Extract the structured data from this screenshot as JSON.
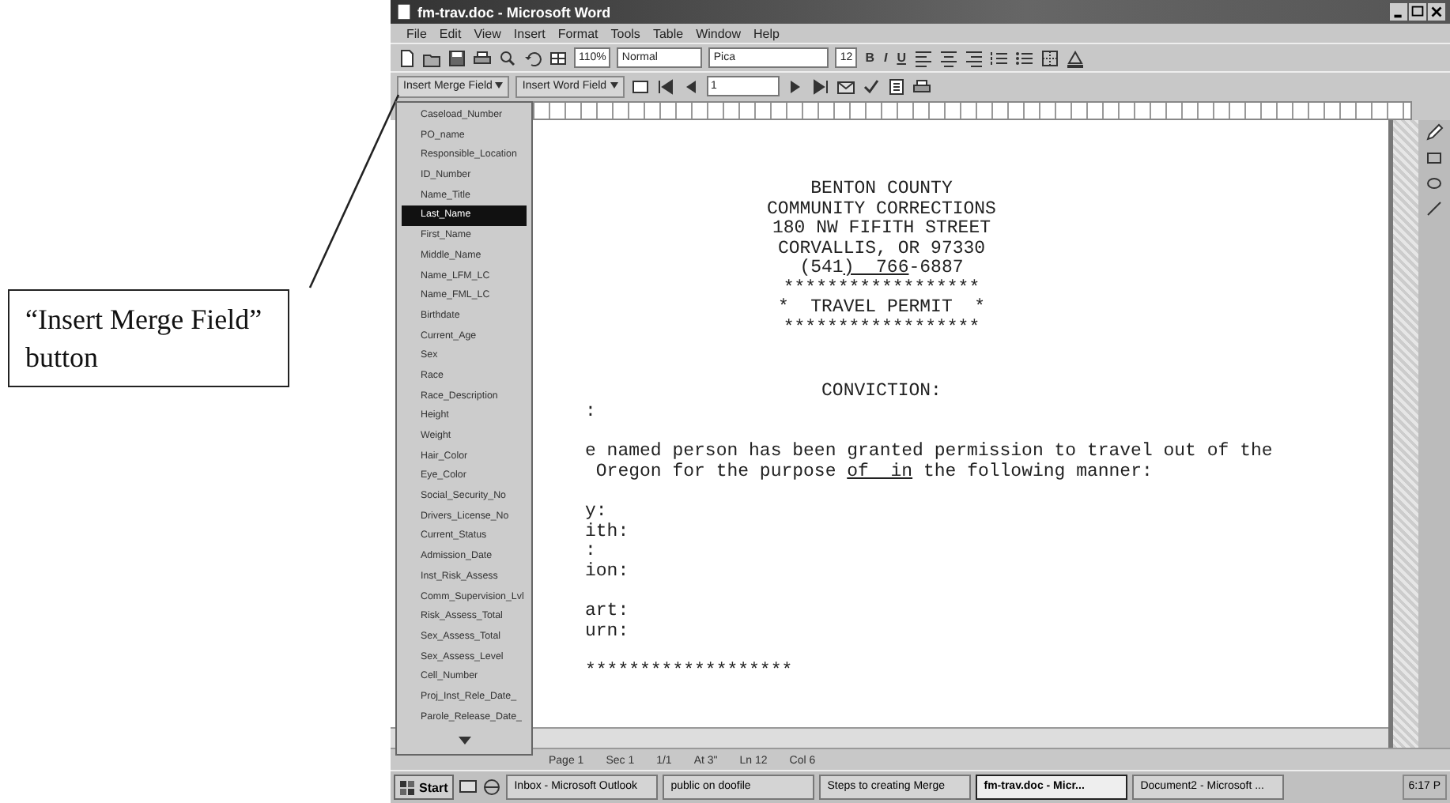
{
  "callout": {
    "text": "“Insert Merge Field” button"
  },
  "window": {
    "title": "fm-trav.doc - Microsoft Word"
  },
  "menu_bar": [
    "File",
    "Edit",
    "View",
    "Insert",
    "Format",
    "Tools",
    "Table",
    "Window",
    "Help"
  ],
  "toolbar": {
    "zoom": "110%",
    "style": "Normal",
    "font": "Pica",
    "size": "12",
    "bold": "B",
    "italic": "I",
    "underline": "U"
  },
  "mail_merge_toolbar": {
    "insert_merge_field": "Insert Merge Field",
    "insert_word_field": "Insert Word Field",
    "record": "1"
  },
  "merge_field_menu": {
    "items": [
      {
        "label": "Caseload_Number",
        "selected": false
      },
      {
        "label": "PO_name",
        "selected": false
      },
      {
        "label": "Responsible_Location",
        "selected": false
      },
      {
        "label": "ID_Number",
        "selected": false
      },
      {
        "label": "Name_Title",
        "selected": false
      },
      {
        "label": "Last_Name",
        "selected": true
      },
      {
        "label": "First_Name",
        "selected": false
      },
      {
        "label": "Middle_Name",
        "selected": false
      },
      {
        "label": "Name_LFM_LC",
        "selected": false
      },
      {
        "label": "Name_FML_LC",
        "selected": false
      },
      {
        "label": "Birthdate",
        "selected": false
      },
      {
        "label": "Current_Age",
        "selected": false
      },
      {
        "label": "Sex",
        "selected": false
      },
      {
        "label": "Race",
        "selected": false
      },
      {
        "label": "Race_Description",
        "selected": false
      },
      {
        "label": "Height",
        "selected": false
      },
      {
        "label": "Weight",
        "selected": false
      },
      {
        "label": "Hair_Color",
        "selected": false
      },
      {
        "label": "Eye_Color",
        "selected": false
      },
      {
        "label": "Social_Security_No",
        "selected": false
      },
      {
        "label": "Drivers_License_No",
        "selected": false
      },
      {
        "label": "Current_Status",
        "selected": false
      },
      {
        "label": "Admission_Date",
        "selected": false
      },
      {
        "label": "Inst_Risk_Assess",
        "selected": false
      },
      {
        "label": "Comm_Supervision_Lvl",
        "selected": false
      },
      {
        "label": "Risk_Assess_Total",
        "selected": false
      },
      {
        "label": "Sex_Assess_Total",
        "selected": false
      },
      {
        "label": "Sex_Assess_Level",
        "selected": false
      },
      {
        "label": "Cell_Number",
        "selected": false
      },
      {
        "label": "Proj_Inst_Rele_Date_",
        "selected": false
      },
      {
        "label": "Parole_Release_Date_",
        "selected": false
      }
    ]
  },
  "document": {
    "header": [
      {
        "segments": [
          {
            "text": "BENTON COUNTY",
            "underline": false
          }
        ]
      },
      {
        "segments": [
          {
            "text": "COMMUNITY CORRECTIONS",
            "underline": false
          }
        ]
      },
      {
        "segments": [
          {
            "text": "180 NW FIFITH STREET",
            "underline": false
          }
        ]
      },
      {
        "segments": [
          {
            "text": "CORVALLIS, OR 97330",
            "underline": false
          }
        ]
      },
      {
        "segments": [
          {
            "text": "(541",
            "underline": false
          },
          {
            "text": ")  766",
            "underline": true
          },
          {
            "text": "-6887",
            "underline": false
          }
        ]
      },
      {
        "segments": [
          {
            "text": "******************",
            "underline": false
          }
        ]
      },
      {
        "segments": [
          {
            "text": "*  TRAVEL PERMIT  *",
            "underline": false
          }
        ]
      },
      {
        "segments": [
          {
            "text": "******************",
            "underline": false
          }
        ]
      }
    ],
    "section_title": "CONVICTION:",
    "body": [
      [
        {
          "segments": [
            {
              "text": ":",
              "underline": false
            }
          ]
        }
      ],
      [
        {
          "segments": [
            {
              "text": "e named person has been granted permission to travel out of the",
              "underline": false
            }
          ]
        },
        {
          "segments": [
            {
              "text": " Oregon for the purpose ",
              "underline": false
            },
            {
              "text": "of  in",
              "underline": true
            },
            {
              "text": " the following manner:",
              "underline": false
            }
          ]
        }
      ],
      [
        {
          "segments": [
            {
              "text": "y:",
              "underline": false
            }
          ]
        },
        {
          "segments": [
            {
              "text": "ith:",
              "underline": false
            }
          ]
        },
        {
          "segments": [
            {
              "text": ":",
              "underline": false
            }
          ]
        },
        {
          "segments": [
            {
              "text": "ion:",
              "underline": false
            }
          ]
        }
      ],
      [
        {
          "segments": [
            {
              "text": "art:",
              "underline": false
            }
          ]
        },
        {
          "segments": [
            {
              "text": "urn:",
              "underline": false
            }
          ]
        }
      ],
      [
        {
          "segments": [
            {
              "text": "*******************",
              "underline": false
            }
          ]
        }
      ]
    ]
  },
  "status_bar": {
    "page": "Page 1",
    "section": "Sec 1",
    "pages": "1/1",
    "at": "At 3\"",
    "line": "Ln 12",
    "col": "Col 6"
  },
  "taskbar": {
    "start": "Start",
    "tasks": [
      {
        "label": "Inbox - Microsoft Outlook",
        "selected": false
      },
      {
        "label": "public on doofile",
        "selected": false
      },
      {
        "label": "Steps to creating Merge",
        "selected": false
      },
      {
        "label": "fm-trav.doc - Micr...",
        "selected": true
      },
      {
        "label": "Document2 - Microsoft ...",
        "selected": false
      }
    ],
    "clock": "6:17 P"
  }
}
